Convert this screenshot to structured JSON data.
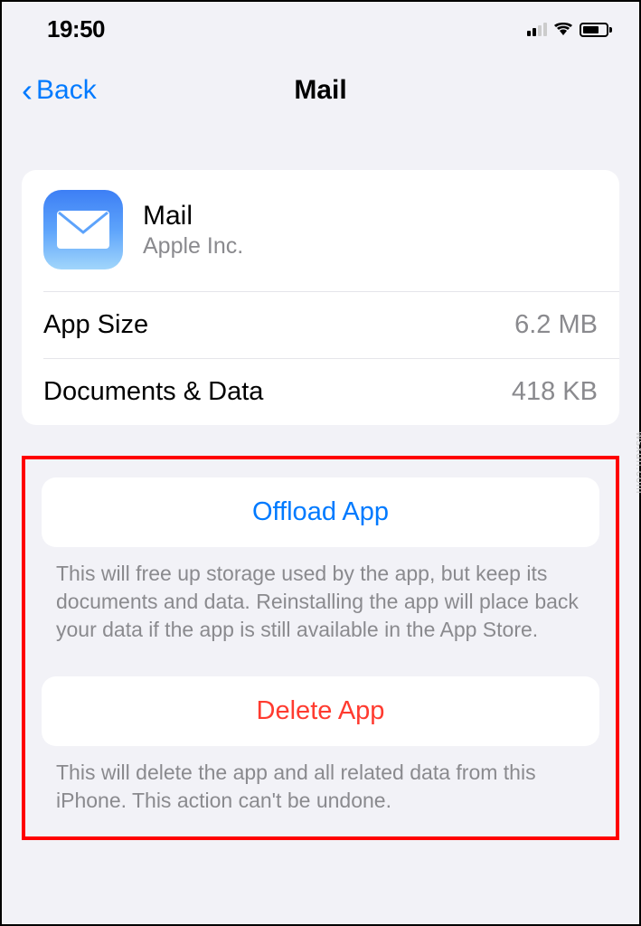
{
  "status_bar": {
    "time": "19:50"
  },
  "nav": {
    "back_label": "Back",
    "title": "Mail"
  },
  "app": {
    "name": "Mail",
    "publisher": "Apple Inc."
  },
  "info": {
    "app_size_label": "App Size",
    "app_size_value": "6.2 MB",
    "docs_label": "Documents & Data",
    "docs_value": "418 KB"
  },
  "actions": {
    "offload_label": "Offload App",
    "offload_description": "This will free up storage used by the app, but keep its documents and data. Reinstalling the app will place back your data if the app is still available in the App Store.",
    "delete_label": "Delete App",
    "delete_description": "This will delete the app and all related data from this iPhone. This action can't be undone."
  },
  "watermark": "wsxdn.com"
}
